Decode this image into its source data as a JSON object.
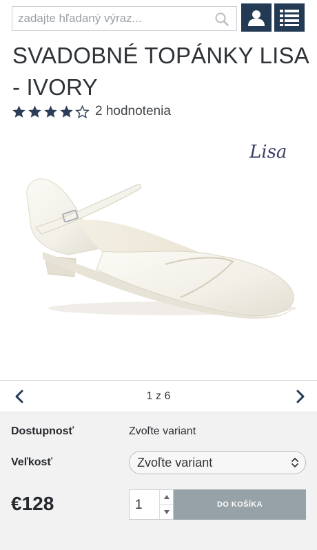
{
  "header": {
    "search_placeholder": "zadajte hľadaný výraz...",
    "icons": [
      "search-icon",
      "user-icon",
      "list-menu-icon"
    ],
    "accent_color": "#233a55"
  },
  "product": {
    "title": "SVADOBNÉ TOPÁNKY LISA - IVORY",
    "rating_stars": 4,
    "rating_max": 5,
    "rating_text": "2 hodnotenia",
    "brand_script": "Lisa"
  },
  "gallery": {
    "counter": "1 z 6",
    "icons": [
      "chevron-left-icon",
      "chevron-right-icon"
    ]
  },
  "purchase": {
    "availability_label": "Dostupnosť",
    "availability_value": "Zvoľte variant",
    "size_label": "Veľkosť",
    "size_selected": "Zvoľte variant",
    "price": "€128",
    "quantity": "1",
    "add_button": "DO KOŠÍKA",
    "button_color": "#96a2a7"
  }
}
